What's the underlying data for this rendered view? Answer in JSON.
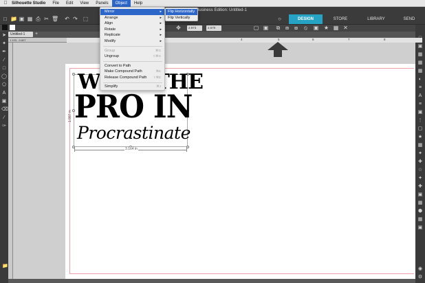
{
  "menubar": {
    "app_name": "Silhouette Studio",
    "items": [
      "File",
      "Edit",
      "View",
      "Panels",
      "Object",
      "Help"
    ],
    "active": "Object"
  },
  "window": {
    "title": "o® Business Edition: Untitled-1"
  },
  "tabs": {
    "design": "DESIGN",
    "store": "STORE",
    "library": "LIBRARY",
    "send": "SEND"
  },
  "toolbar2": {
    "x_field": "2.973",
    "y_field": "2.570"
  },
  "document": {
    "tab_label": "Untitled-1",
    "coordinate_readout": "1.193, -0.807"
  },
  "ruler": {
    "marks": [
      "4",
      "5",
      "6",
      "7",
      "8"
    ]
  },
  "artwork": {
    "line1": "WHAT THE",
    "line2": "PRO IN",
    "line3": "Procrastinate",
    "width_label": "3.164 in",
    "height_label": "1.987 in"
  },
  "object_menu": {
    "items": [
      {
        "label": "Mirror",
        "submenu": true,
        "highlight": true
      },
      {
        "label": "Arrange",
        "submenu": true
      },
      {
        "label": "Align",
        "submenu": true
      },
      {
        "label": "Rotate",
        "submenu": true
      },
      {
        "label": "Replicate",
        "submenu": true
      },
      {
        "label": "Modify",
        "submenu": true
      },
      {
        "label": "Group",
        "shortcut": "⌘G",
        "disabled": true
      },
      {
        "label": "Ungroup",
        "shortcut": "⇧⌘G"
      },
      {
        "label": "Convert to Path"
      },
      {
        "label": "Make Compound Path",
        "shortcut": "⌘E"
      },
      {
        "label": "Release Compound Path",
        "shortcut": "⇧⌘E"
      },
      {
        "label": "Simplify",
        "shortcut": "⌘J"
      }
    ],
    "submenu_arrow": "▸"
  },
  "mirror_submenu": {
    "items": [
      "Flip Horizontally",
      "Flip Vertically"
    ],
    "highlighted": "Flip Horizontally"
  },
  "colors": {
    "accent": "#26a3c4",
    "menu_highlight": "#2c66c9",
    "page_border": "#f2a0a8"
  }
}
